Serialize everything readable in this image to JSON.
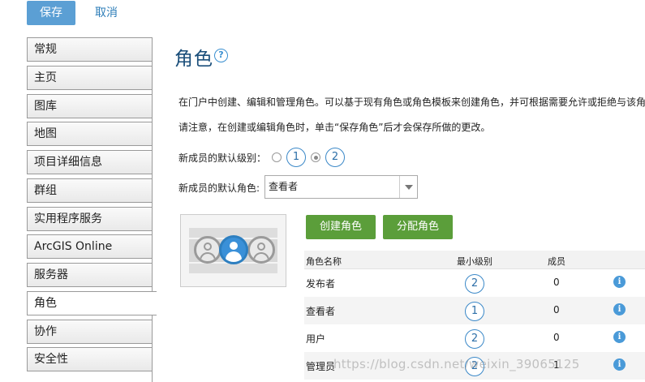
{
  "toolbar": {
    "save_label": "保存",
    "cancel_label": "取消"
  },
  "sidebar": {
    "items": [
      {
        "label": "常规"
      },
      {
        "label": "主页"
      },
      {
        "label": "图库"
      },
      {
        "label": "地图"
      },
      {
        "label": "项目详细信息"
      },
      {
        "label": "群组"
      },
      {
        "label": "实用程序服务"
      },
      {
        "label": "ArcGIS Online"
      },
      {
        "label": "服务器"
      },
      {
        "label": "角色"
      },
      {
        "label": "协作"
      },
      {
        "label": "安全性"
      }
    ],
    "active": "角色"
  },
  "main": {
    "title": "角色",
    "help_icon": "?",
    "description_1": "在门户中创建、编辑和管理角色。可以基于现有角色或角色模板来创建角色，并可根据需要允许或拒绝与该角",
    "description_2": "请注意，在创建或编辑角色时，单击“保存角色”后才会保存所做的更改。",
    "default_level_label": "新成员的默认级别：",
    "level_options": [
      "1",
      "2"
    ],
    "selected_level": "2",
    "default_role_label": "新成员的默认角色:",
    "default_role_value": "查看者",
    "create_role_button": "创建角色",
    "assign_role_button": "分配角色",
    "table": {
      "headers": [
        "角色名称",
        "最小级别",
        "成员"
      ],
      "rows": [
        {
          "name": "发布者",
          "level": "2",
          "members": "0"
        },
        {
          "name": "查看者",
          "level": "1",
          "members": "0"
        },
        {
          "name": "用户",
          "level": "2",
          "members": "0"
        },
        {
          "name": "管理员",
          "level": "2",
          "members": "1"
        }
      ]
    }
  },
  "watermark": "https://blog.csdn.net/weixin_39065125",
  "colors": {
    "primary_button": "#5b9fd4",
    "green_button": "#5b9e3a",
    "title": "#1a4e7a",
    "info_icon": "#4a9ad8"
  }
}
